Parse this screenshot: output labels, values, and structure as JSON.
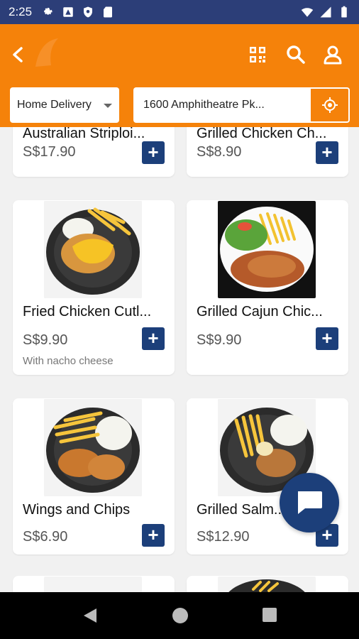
{
  "status_bar": {
    "time": "2:25"
  },
  "header": {
    "delivery_mode": "Home Delivery",
    "address": "1600 Amphitheatre Pk..."
  },
  "products": [
    {
      "name": "Australian Striploi...",
      "price": "S$17.90",
      "note": ""
    },
    {
      "name": "Grilled Chicken Ch...",
      "price": "S$8.90",
      "note": ""
    },
    {
      "name": "Fried Chicken Cutl...",
      "price": "S$9.90",
      "note": "With nacho cheese"
    },
    {
      "name": "Grilled Cajun Chic...",
      "price": "S$9.90",
      "note": ""
    },
    {
      "name": "Wings and Chips",
      "price": "S$6.90",
      "note": ""
    },
    {
      "name": "Grilled Salm...",
      "price": "S$12.90",
      "note": ""
    }
  ],
  "add_label": "+",
  "colors": {
    "primary": "#f5820a",
    "accent": "#1c3f7a",
    "status_bar": "#2c3e78"
  }
}
